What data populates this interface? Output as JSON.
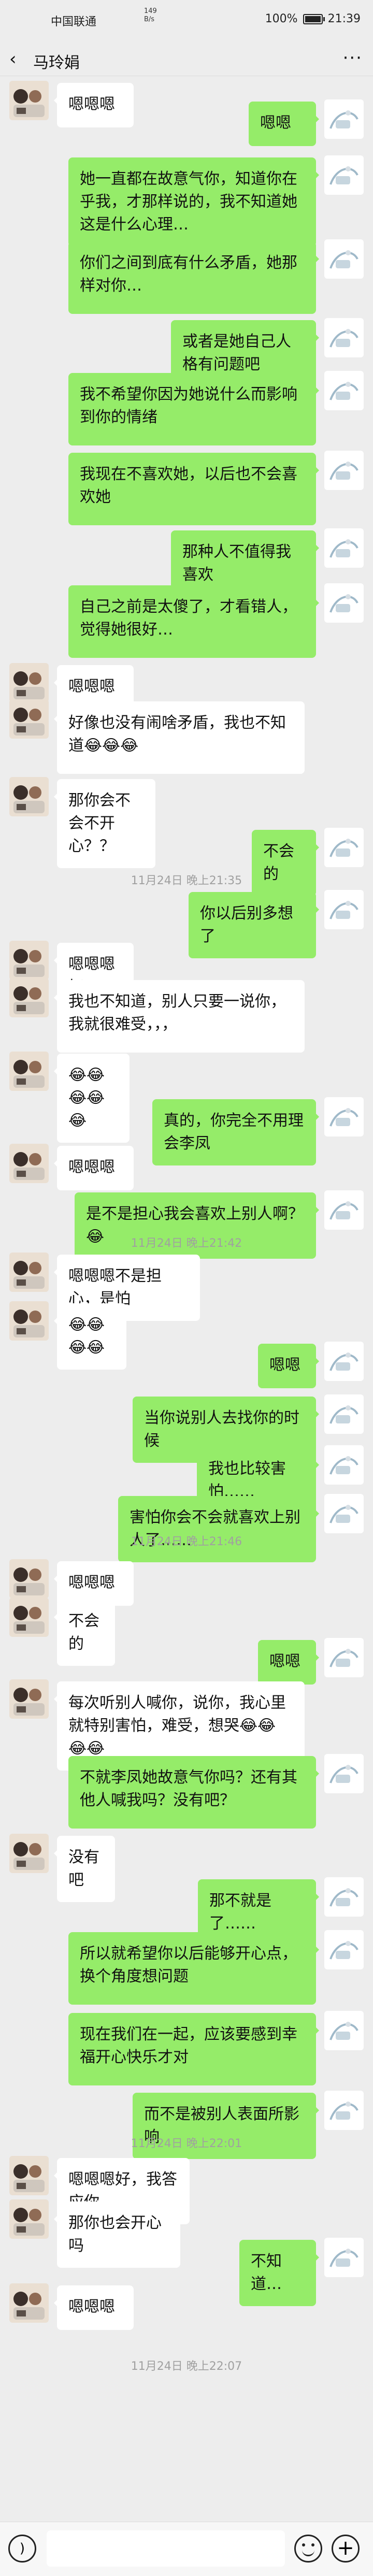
{
  "status_bar": {
    "carrier": "中国联通",
    "network": "149\nB/s",
    "battery": "100%",
    "time": "21:39"
  },
  "header": {
    "title": "马玲娟"
  },
  "messages": [
    {
      "type": "left",
      "text": "嗯嗯嗯"
    },
    {
      "type": "right",
      "text": "嗯嗯"
    },
    {
      "type": "right",
      "text": "她一直都在故意气你，知道你在乎我，才那样说的，我不知道她这是什么心理…"
    },
    {
      "type": "right",
      "text": "你们之间到底有什么矛盾，她那样对你…"
    },
    {
      "type": "right",
      "text": "或者是她自己人格有问题吧"
    },
    {
      "type": "right",
      "text": "我不希望你因为她说什么而影响到你的情绪"
    },
    {
      "type": "right",
      "text": "我现在不喜欢她，以后也不会喜欢她"
    },
    {
      "type": "right",
      "text": "那种人不值得我喜欢"
    },
    {
      "type": "right",
      "text": "自己之前是太傻了，才看错人，觉得她很好…"
    },
    {
      "type": "left",
      "text": "嗯嗯嗯"
    },
    {
      "type": "left",
      "text": "好像也没有闹啥矛盾，我也不知道😂😂😂"
    },
    {
      "type": "left",
      "text": "那你会不会不开心？？"
    },
    {
      "type": "right",
      "text": "不会的"
    },
    {
      "type": "time",
      "text": "11月24日 晚上21:35"
    },
    {
      "type": "right",
      "text": "你以后别多想了"
    },
    {
      "type": "left",
      "text": "嗯嗯嗯好"
    },
    {
      "type": "left",
      "text": "我也不知道，别人只要一说你，我就很难受，，，"
    },
    {
      "type": "left",
      "text": "😂😂😂😂😂"
    },
    {
      "type": "right",
      "text": "真的，你完全不用理会李凤"
    },
    {
      "type": "left",
      "text": "嗯嗯嗯"
    },
    {
      "type": "right",
      "text": "是不是担心我会喜欢上别人啊？😂"
    },
    {
      "type": "time",
      "text": "11月24日 晚上21:42"
    },
    {
      "type": "left",
      "text": "嗯嗯嗯不是担心，是怕"
    },
    {
      "type": "left",
      "text": "😂😂😂😂"
    },
    {
      "type": "right",
      "text": "嗯嗯"
    },
    {
      "type": "right",
      "text": "当你说别人去找你的时候"
    },
    {
      "type": "right",
      "text": "我也比较害怕……"
    },
    {
      "type": "right",
      "text": "害怕你会不会就喜欢上别人了……"
    },
    {
      "type": "time",
      "text": "11月24日 晚上21:46"
    },
    {
      "type": "left",
      "text": "嗯嗯嗯"
    },
    {
      "type": "left",
      "text": "不会的"
    },
    {
      "type": "right",
      "text": "嗯嗯"
    },
    {
      "type": "left",
      "text": "每次听别人喊你，说你，我心里就特别害怕，难受，想哭😂😂😂😂"
    },
    {
      "type": "right",
      "text": "不就李凤她故意气你吗？还有其他人喊我吗？没有吧？"
    },
    {
      "type": "left",
      "text": "没有吧"
    },
    {
      "type": "right",
      "text": "那不就是了……"
    },
    {
      "type": "right",
      "text": "所以就希望你以后能够开心点，换个角度想问题"
    },
    {
      "type": "right",
      "text": "现在我们在一起，应该要感到幸福开心快乐才对"
    },
    {
      "type": "right",
      "text": "而不是被别人表面所影响"
    },
    {
      "type": "time",
      "text": "11月24日 晚上22:01"
    },
    {
      "type": "left",
      "text": "嗯嗯嗯好，我答应你"
    },
    {
      "type": "left",
      "text": "那你也会开心吗"
    },
    {
      "type": "right",
      "text": "不知道…"
    },
    {
      "type": "left",
      "text": "嗯嗯嗯"
    },
    {
      "type": "time",
      "text": "11月24日 晚上22:07"
    }
  ]
}
